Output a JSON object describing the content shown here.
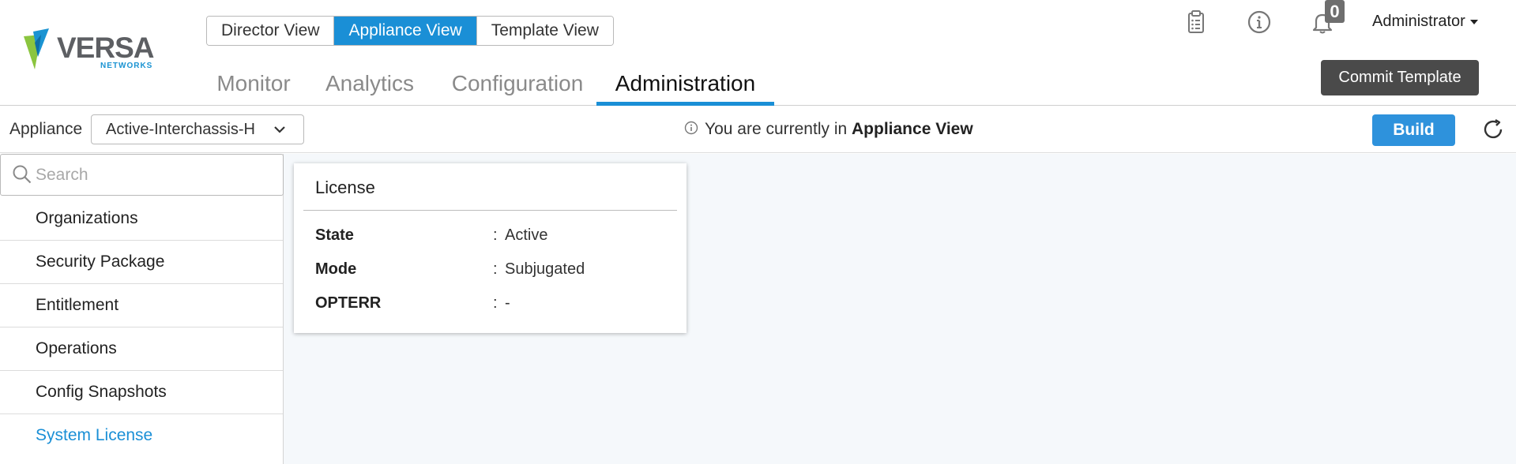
{
  "brand": {
    "name": "VERSA",
    "sub": "NETWORKS",
    "colors": {
      "primary": "#1a8fd6",
      "logo_green": "#8bc53f",
      "logo_blue": "#1a93d2",
      "logo_gray": "#5d5f63"
    }
  },
  "view_toggle": {
    "items": [
      {
        "label": "Director View",
        "active": false
      },
      {
        "label": "Appliance View",
        "active": true
      },
      {
        "label": "Template View",
        "active": false
      }
    ]
  },
  "main_tabs": [
    {
      "label": "Monitor",
      "active": false
    },
    {
      "label": "Analytics",
      "active": false
    },
    {
      "label": "Configuration",
      "active": false
    },
    {
      "label": "Administration",
      "active": true
    }
  ],
  "header_icons": [
    "clipboard-icon",
    "info-icon",
    "bell-icon"
  ],
  "notifications": {
    "count": "0"
  },
  "user": {
    "name": "Administrator"
  },
  "commit_button": {
    "label": "Commit Template"
  },
  "appliance_bar": {
    "label": "Appliance",
    "selected": "Active-Interchassis-H",
    "message_prefix": "You are currently in",
    "message_view": "Appliance View",
    "build_label": "Build"
  },
  "search": {
    "placeholder": "Search",
    "value": ""
  },
  "sidebar": {
    "items": [
      {
        "label": "Organizations",
        "active": false
      },
      {
        "label": "Security Package",
        "active": false
      },
      {
        "label": "Entitlement",
        "active": false
      },
      {
        "label": "Operations",
        "active": false
      },
      {
        "label": "Config Snapshots",
        "active": false
      },
      {
        "label": "System License",
        "active": true
      }
    ]
  },
  "license_card": {
    "title": "License",
    "rows": [
      {
        "key": "State",
        "sep": ":",
        "value": "Active"
      },
      {
        "key": "Mode",
        "sep": ":",
        "value": "Subjugated"
      },
      {
        "key": "OPTERR",
        "sep": ":",
        "value": "-"
      }
    ]
  }
}
